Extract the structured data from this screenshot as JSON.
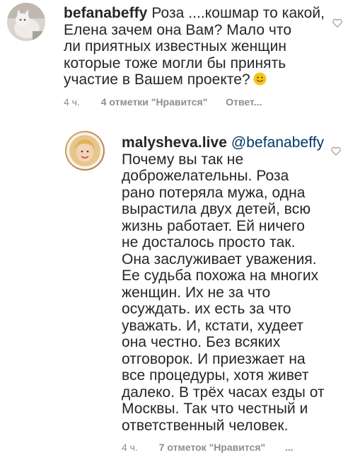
{
  "comment1": {
    "username": "befanabeffy",
    "text_lines": [
      "Роза ....кошмар то какой,",
      "Елена зачем она Вам? Мало что",
      "ли приятных известных женщин",
      "которые тоже могли бы принять",
      "участие в Вашем проекте?"
    ],
    "emoji": "smile-emoji",
    "time": "4 ч.",
    "likes": "4 отметки \"Нравится\"",
    "reply": "Ответ..."
  },
  "comment2": {
    "username": "malysheva.live",
    "mention": "@befanabeffy",
    "text_lines": [
      "Почему вы так не",
      "доброжелательны. Роза",
      "рано потеряла мужа, одна",
      "вырастила двух детей, всю",
      "жизнь  работает. Ей ничего",
      "не досталось просто так.",
      "Она заслуживает уважения.",
      "Ее судьба похожа на многих",
      "женщин. Их не за что",
      "осуждать. их есть за что",
      "уважать. И, кстати, худеет",
      "она честно. Без всяких",
      "отговорок. И приезжает на",
      "все процедуры, хотя живет",
      "далеко. В трёх часах езды от",
      "Москвы. Так что честный и",
      "ответственный человек."
    ],
    "time": "4 ч.",
    "likes": "7 отметок \"Нравится\"",
    "more": "..."
  },
  "icons": {
    "like": "heart-outline-icon"
  },
  "colors": {
    "text": "#262626",
    "meta": "#8e8e8e",
    "mention": "#00376b",
    "heart": "#8e8e8e",
    "emoji": "#f5c518"
  }
}
